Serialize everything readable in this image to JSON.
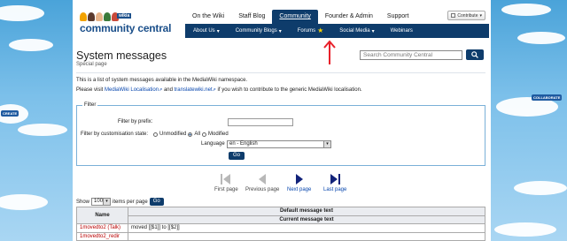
{
  "header": {
    "logo_text": "community central",
    "logo_badge": "wikia",
    "top_nav": [
      "On the Wiki",
      "Staff Blog",
      "Community",
      "Founder & Admin",
      "Support"
    ],
    "top_nav_active": 2,
    "contribute_label": "Contribute",
    "sub_nav": [
      "About Us",
      "Community Blogs",
      "Forums",
      "Social Media",
      "Webinars"
    ]
  },
  "page": {
    "title": "System messages",
    "subtitle": "Special page"
  },
  "search": {
    "placeholder": "Search Community Central"
  },
  "intro": {
    "line1": "This is a list of system messages available in the MediaWiki namespace.",
    "line2_prefix": "Please visit",
    "link1": "MediaWiki Localisation",
    "line2_mid": "and",
    "link2": "translatewiki.net",
    "line2_suffix": "if you wish to contribute to the generic MediaWiki localisation."
  },
  "filter": {
    "legend": "Filter",
    "prefix_label": "Filter by prefix:",
    "prefix_value": "",
    "state_label": "Filter by customisation state:",
    "state_options": [
      "Unmodified",
      "All",
      "Modified"
    ],
    "state_selected": "All",
    "language_label": "Language",
    "language_value": "en - English",
    "go_label": "Go"
  },
  "pager": {
    "first": "First page",
    "previous": "Previous page",
    "next": "Next page",
    "last": "Last page"
  },
  "show": {
    "prefix": "Show",
    "value": "100",
    "suffix": "items per page",
    "go_label": "Go"
  },
  "table": {
    "col_name": "Name",
    "col_default": "Default message text",
    "col_current": "Current message text",
    "rows": [
      {
        "name": "1movedto2 (Talk)",
        "text": "moved [[$1]] to [[$2]]"
      },
      {
        "name": "1movedto2_redir",
        "text": ""
      }
    ]
  },
  "side_badges": {
    "left": "CREATE",
    "right": "COLLABORATE"
  },
  "colors": {
    "nav_dark": "#0e3c6b",
    "link": "#0645ad",
    "redlink": "#ba0000",
    "annotation": "#e8202a"
  }
}
